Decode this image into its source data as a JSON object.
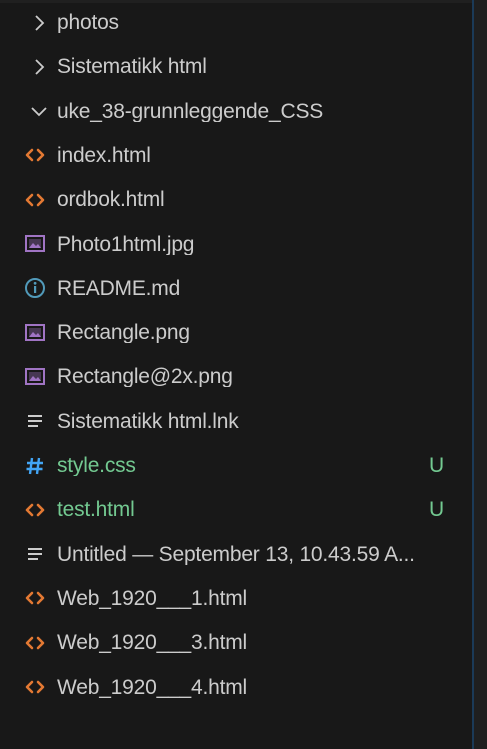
{
  "colors": {
    "background": "#181818",
    "text": "#cccccc",
    "modified_text": "#73c991",
    "html_icon": "#e37933",
    "image_icon": "#a074c4",
    "info_icon": "#519aba",
    "css_icon": "#42a5f5",
    "lines_icon": "#cccccc",
    "divider": "#1b3a57"
  },
  "tree": [
    {
      "type": "folder",
      "label": "photos",
      "icon": "chevron-right-icon"
    },
    {
      "type": "folder",
      "label": "Sistematikk html",
      "icon": "chevron-right-icon"
    },
    {
      "type": "folder",
      "label": "uke_38-grunnleggende_CSS",
      "icon": "chevron-down-icon"
    },
    {
      "type": "file",
      "label": "index.html",
      "icon": "html-icon"
    },
    {
      "type": "file",
      "label": "ordbok.html",
      "icon": "html-icon"
    },
    {
      "type": "file",
      "label": "Photo1html.jpg",
      "icon": "image-icon"
    },
    {
      "type": "file",
      "label": "README.md",
      "icon": "info-icon"
    },
    {
      "type": "file",
      "label": "Rectangle.png",
      "icon": "image-icon"
    },
    {
      "type": "file",
      "label": "Rectangle@2x.png",
      "icon": "image-icon"
    },
    {
      "type": "file",
      "label": "Sistematikk html.lnk",
      "icon": "lines-icon"
    },
    {
      "type": "file",
      "label": "style.css",
      "icon": "css-hash-icon",
      "badge": "U"
    },
    {
      "type": "file",
      "label": "test.html",
      "icon": "html-icon",
      "badge": "U"
    },
    {
      "type": "file",
      "label": "Untitled — September 13, 10.43.59 A...",
      "icon": "lines-icon"
    },
    {
      "type": "file",
      "label": "Web_1920___1.html",
      "icon": "html-icon"
    },
    {
      "type": "file",
      "label": "Web_1920___3.html",
      "icon": "html-icon"
    },
    {
      "type": "file",
      "label": "Web_1920___4.html",
      "icon": "html-icon"
    }
  ]
}
